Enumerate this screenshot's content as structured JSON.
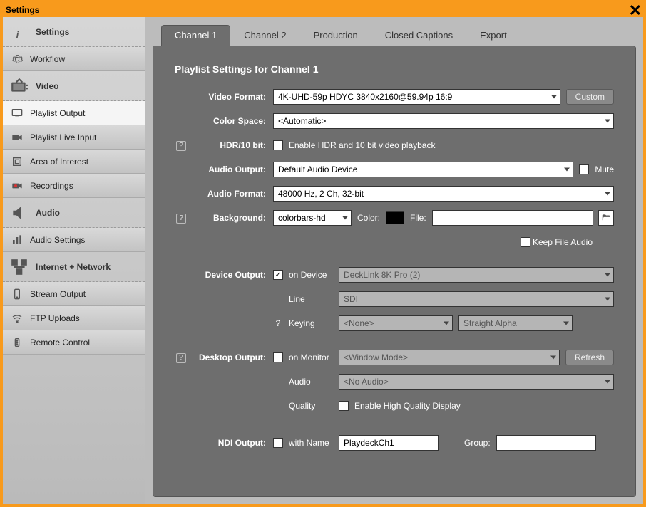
{
  "window": {
    "title": "Settings"
  },
  "sidebar": {
    "groups": [
      {
        "label": "Settings",
        "items": [
          {
            "label": "Workflow"
          }
        ]
      },
      {
        "label": "Video",
        "items": [
          {
            "label": "Playlist Output",
            "active": true
          },
          {
            "label": "Playlist Live Input"
          },
          {
            "label": "Area of Interest"
          },
          {
            "label": "Recordings"
          }
        ]
      },
      {
        "label": "Audio",
        "items": [
          {
            "label": "Audio Settings"
          }
        ]
      },
      {
        "label": "Internet + Network",
        "items": [
          {
            "label": "Stream Output"
          },
          {
            "label": "FTP Uploads"
          },
          {
            "label": "Remote Control"
          }
        ]
      }
    ]
  },
  "tabs": [
    "Channel 1",
    "Channel 2",
    "Production",
    "Closed Captions",
    "Export"
  ],
  "active_tab": 0,
  "panel": {
    "title": "Playlist Settings for Channel 1",
    "video_format_label": "Video Format:",
    "video_format": "4K-UHD-59p HDYC 3840x2160@59.94p 16:9",
    "custom_button": "Custom",
    "color_space_label": "Color Space:",
    "color_space": "<Automatic>",
    "hdr_label": "HDR/10 bit:",
    "hdr_checkbox_label": "Enable HDR and 10 bit video playback",
    "audio_output_label": "Audio Output:",
    "audio_output": "Default Audio Device",
    "mute_label": "Mute",
    "audio_format_label": "Audio Format:",
    "audio_format": "48000 Hz, 2 Ch, 32-bit",
    "background_label": "Background:",
    "background": "colorbars-hd",
    "bg_color_label": "Color:",
    "bg_color": "#000000",
    "bg_file_label": "File:",
    "bg_file": "",
    "keep_file_audio_label": "Keep File Audio",
    "device_output_label": "Device Output:",
    "device_on_device_label": "on Device",
    "device_output": "DeckLink 8K Pro (2)",
    "device_line_label": "Line",
    "device_line": "SDI",
    "device_keying_label": "Keying",
    "device_keying_mode": "<None>",
    "device_keying_alpha": "Straight Alpha",
    "desktop_output_label": "Desktop Output:",
    "desktop_on_monitor_label": "on Monitor",
    "desktop_monitor": "<Window Mode>",
    "refresh_button": "Refresh",
    "desktop_audio_label": "Audio",
    "desktop_audio": "<No Audio>",
    "desktop_quality_label": "Quality",
    "desktop_hq_label": "Enable High Quality Display",
    "ndi_output_label": "NDI Output:",
    "ndi_with_name_label": "with Name",
    "ndi_name": "PlaydeckCh1",
    "ndi_group_label": "Group:",
    "ndi_group": ""
  }
}
